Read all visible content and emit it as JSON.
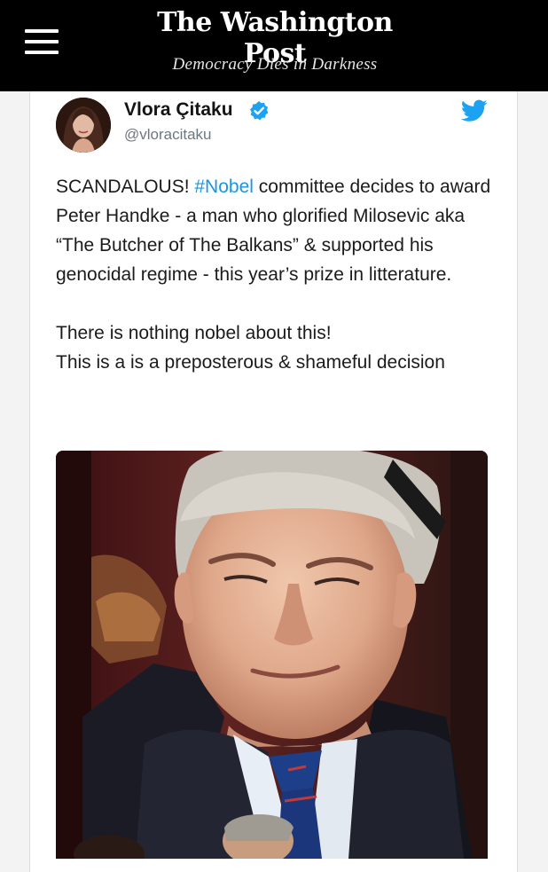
{
  "header": {
    "masthead": "The Washington Post",
    "tagline": "Democracy Dies in Darkness",
    "menu_icon": "hamburger-menu-icon"
  },
  "tweet": {
    "author_name": "Vlora Çitaku",
    "handle": "@vloracitaku",
    "verified_icon": "verified-badge-icon",
    "platform_icon": "twitter-bird-icon",
    "paragraph1": {
      "before_hashtag": "SCANDALOUS! ",
      "hashtag": "#Nobel",
      "after_hashtag": " committee decides to award Peter Handke - a man who glorified Milosevic aka “The Butcher of The Balkans” & supported his genocidal regime - this year’s prize in litterature."
    },
    "paragraph2_line1": "There is nothing nobel about this!",
    "paragraph2_line2": "This is a is a preposterous & shameful decision"
  },
  "colors": {
    "header_bg": "#000000",
    "link_blue": "#1b95e0",
    "twitter_blue": "#1da1f2",
    "handle_gray": "#6e7780"
  }
}
